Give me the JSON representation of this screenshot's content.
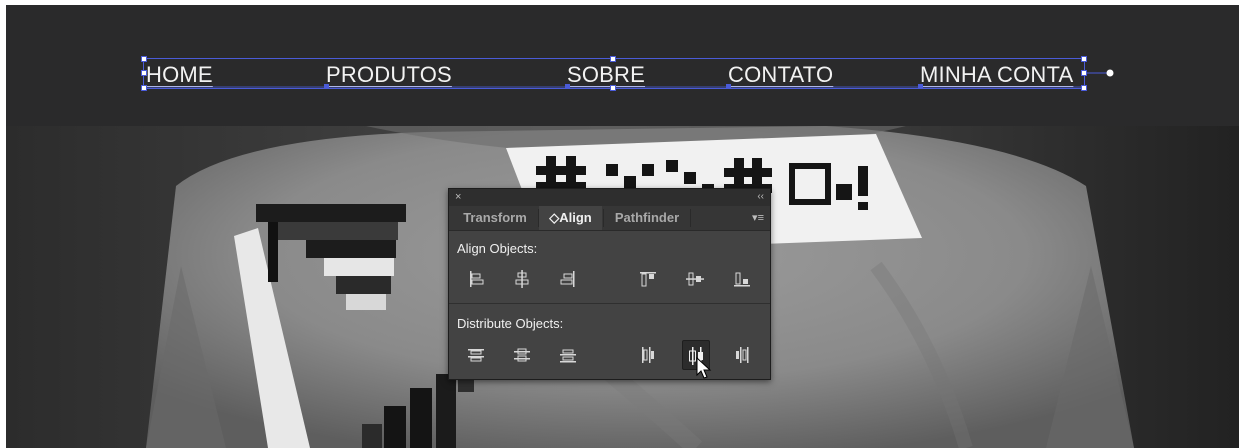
{
  "nav": {
    "items": [
      {
        "label": "HOME"
      },
      {
        "label": "PRODUTOS"
      },
      {
        "label": "SOBRE"
      },
      {
        "label": "CONTATO"
      },
      {
        "label": "MINHA CONTA"
      }
    ]
  },
  "panel": {
    "close_glyph": "×",
    "collapse_glyph": "‹‹",
    "menu_glyph": "▾≡",
    "tabs": [
      {
        "label": "Transform",
        "active": false
      },
      {
        "label": "◇Align",
        "active": true
      },
      {
        "label": "Pathfinder",
        "active": false
      }
    ],
    "align_section": {
      "title": "Align Objects:",
      "buttons": [
        {
          "icon": "horizontal-align-left-icon"
        },
        {
          "icon": "horizontal-align-center-icon"
        },
        {
          "icon": "horizontal-align-right-icon"
        },
        {
          "icon": "vertical-align-top-icon"
        },
        {
          "icon": "vertical-align-center-icon"
        },
        {
          "icon": "vertical-align-bottom-icon"
        }
      ]
    },
    "distribute_section": {
      "title": "Distribute Objects:",
      "buttons": [
        {
          "icon": "vertical-distribute-top-icon"
        },
        {
          "icon": "vertical-distribute-center-icon"
        },
        {
          "icon": "vertical-distribute-bottom-icon"
        },
        {
          "icon": "horizontal-distribute-left-icon"
        },
        {
          "icon": "horizontal-distribute-center-icon",
          "pressed": true
        },
        {
          "icon": "horizontal-distribute-right-icon"
        }
      ]
    }
  },
  "colors": {
    "selection": "#4a5bd8",
    "header_background": "#2a2a2b",
    "panel_background": "#434343"
  }
}
